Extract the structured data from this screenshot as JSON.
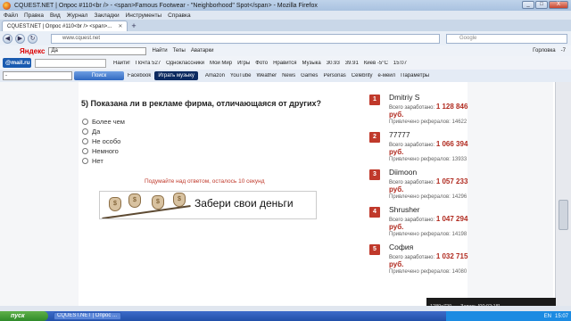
{
  "window": {
    "title": "CQUEST.NET | Опрос #110<br /> - <span>Famous Footwear - \"Neighborhood\" Spot</span> - Mozilla Firefox",
    "controls": [
      "_",
      "□",
      "X"
    ]
  },
  "menu": [
    "Файл",
    "Правка",
    "Вид",
    "Журнал",
    "Закладки",
    "Инструменты",
    "Справка"
  ],
  "tabs": [
    {
      "label": "CQUEST.NET | Опрос #110<br /> <span>..."
    }
  ],
  "nav": {
    "url": "www.cquest.net",
    "search_placeholder": "Google"
  },
  "yandex_bar": {
    "logo": "Яндекс",
    "query": "Да",
    "items": [
      "Найти",
      "Тепы",
      "Аватарки",
      "Горловка",
      "-7"
    ]
  },
  "mailru_bar": {
    "logo": "@mail.ru",
    "items": [
      "Найти!",
      "Почта 527",
      "Одноклассники",
      "Мой Мир",
      "Игры",
      "Фото",
      "Нравится",
      "Музыка",
      "30.93",
      "39.91",
      "Киев -5°C",
      "15:07"
    ]
  },
  "social_bar": {
    "select_value": "-",
    "find_label": "Поиск",
    "music_label": "Играть музыку",
    "items": [
      "Facebook",
      "Amazon",
      "YouTube",
      "Weather",
      "News",
      "Games",
      "Personas",
      "Celebrity",
      "e-мейл",
      "Параметры"
    ]
  },
  "question": {
    "text": "5) Показана ли в рекламе фирма, отличающаяся от других?",
    "options": [
      "Более чем",
      "Да",
      "Не особо",
      "Немного",
      "Нет"
    ],
    "timer": "Подумайте над ответом, осталось 10 секунд",
    "banner_text": "Забери свои деньги",
    "bag_symbol": "$"
  },
  "leaderboard": [
    {
      "rank": "1",
      "name": "Dmitriy S",
      "earned_label": "Всего заработано:",
      "amount": "1 128 846",
      "currency": "руб.",
      "ref_label": "Привлечено рефералов:",
      "refs": "14622"
    },
    {
      "rank": "2",
      "name": "77777",
      "earned_label": "Всего заработано:",
      "amount": "1 066 394",
      "currency": "руб.",
      "ref_label": "Привлечено рефералов:",
      "refs": "13933"
    },
    {
      "rank": "3",
      "name": "Diimoon",
      "earned_label": "Всего заработано:",
      "amount": "1 057 233",
      "currency": "руб.",
      "ref_label": "Привлечено рефералов:",
      "refs": "14296"
    },
    {
      "rank": "4",
      "name": "Shrusher",
      "earned_label": "Всего заработано:",
      "amount": "1 047 294",
      "currency": "руб.",
      "ref_label": "Привлечено рефералов:",
      "refs": "14198"
    },
    {
      "rank": "5",
      "name": "София",
      "earned_label": "Всего заработано:",
      "amount": "1 032 715",
      "currency": "руб.",
      "ref_label": "Привлечено рефералов:",
      "refs": "14080"
    }
  ],
  "recorder": {
    "resolution": "1280x720",
    "status": "Запись [00:02:18]"
  },
  "taskbar": {
    "start": "пуск",
    "task": "CQUEST.NET | Опрос ...",
    "lang": "EN",
    "clock": "15:07"
  }
}
